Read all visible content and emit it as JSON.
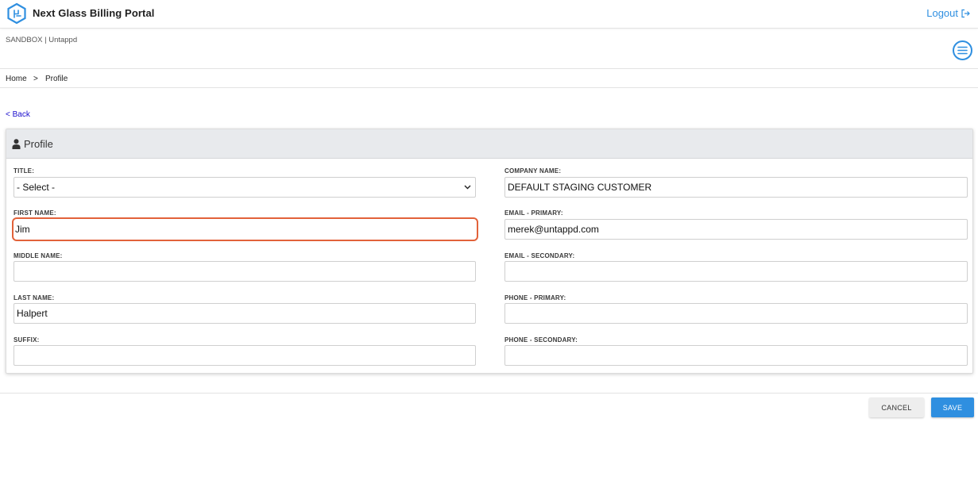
{
  "app": {
    "title": "Next Glass Billing Portal",
    "logout_label": "Logout"
  },
  "environment": {
    "text": "SANDBOX | Untappd"
  },
  "breadcrumb": {
    "home": "Home",
    "separator": ">",
    "current": "Profile"
  },
  "back_label": "< Back",
  "panel": {
    "title": "Profile"
  },
  "form": {
    "title": {
      "label": "TITLE:",
      "value": "- Select -"
    },
    "first_name": {
      "label": "FIRST NAME:",
      "value": "Jim"
    },
    "middle_name": {
      "label": "MIDDLE NAME:",
      "value": ""
    },
    "last_name": {
      "label": "LAST NAME:",
      "value": "Halpert"
    },
    "suffix": {
      "label": "SUFFIX:",
      "value": ""
    },
    "company_name": {
      "label": "COMPANY NAME:",
      "value": "DEFAULT STAGING CUSTOMER"
    },
    "email_primary": {
      "label": "EMAIL - PRIMARY:",
      "value": "merek@untappd.com"
    },
    "email_secondary": {
      "label": "EMAIL - SECONDARY:",
      "value": ""
    },
    "phone_primary": {
      "label": "PHONE - PRIMARY:",
      "value": ""
    },
    "phone_secondary": {
      "label": "PHONE - SECONDARY:",
      "value": ""
    }
  },
  "buttons": {
    "cancel": "CANCEL",
    "save": "SAVE"
  },
  "colors": {
    "accent": "#2f8fe0",
    "focus_outline": "#e2623a",
    "panel_header": "#e8eaed",
    "link": "#1a0dcc"
  },
  "icons": {
    "logo": "hexagon-logo-icon",
    "logout": "logout-icon",
    "menu": "hamburger-menu-icon",
    "user": "user-icon",
    "select": "chevron-down-icon"
  }
}
